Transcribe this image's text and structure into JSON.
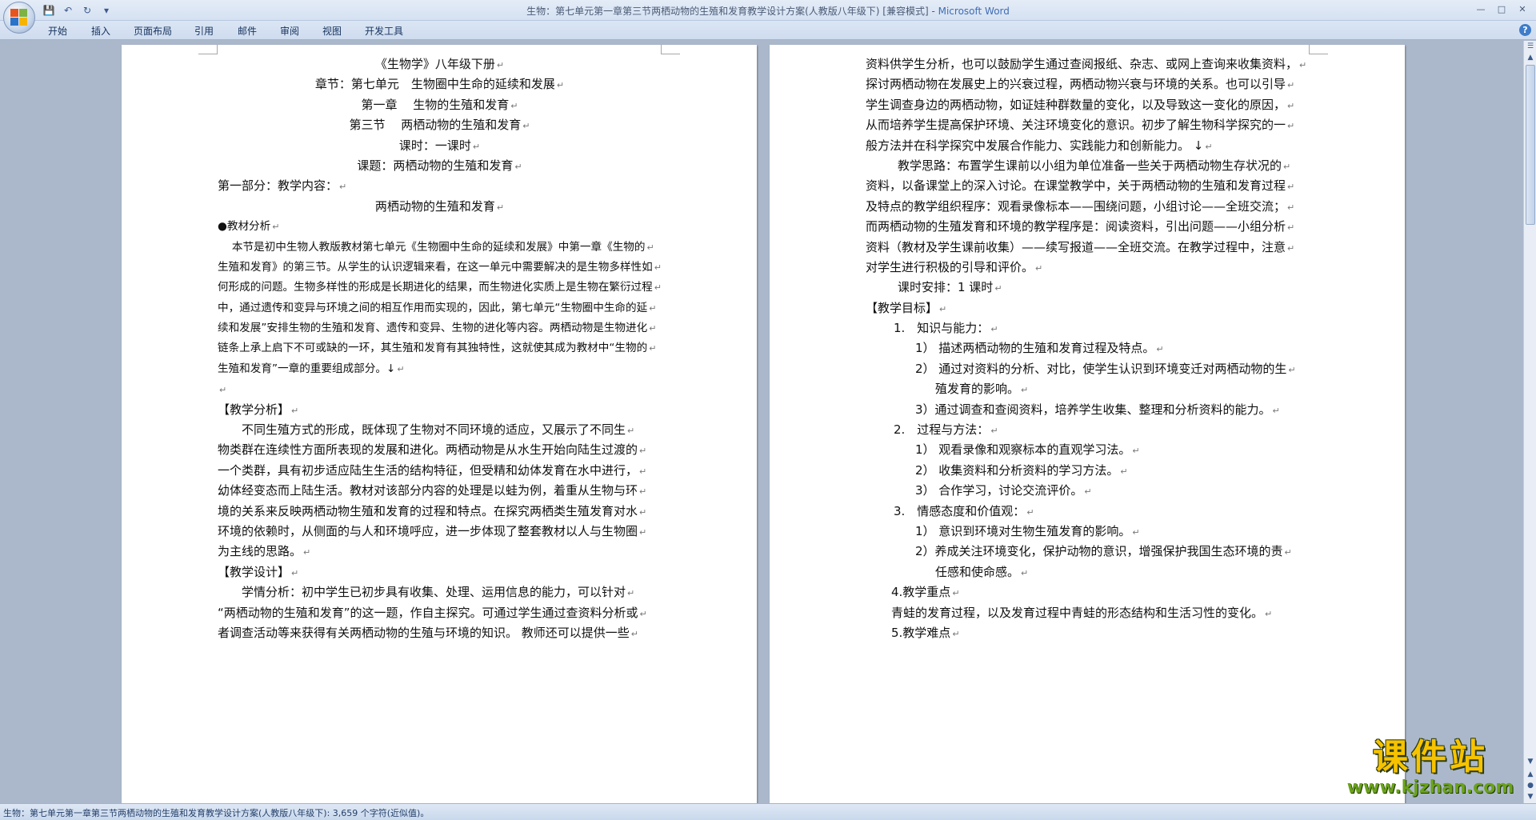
{
  "window": {
    "title_doc": "生物：第七单元第一章第三节两栖动物的生殖和发育教学设计方案(人教版八年级下) [兼容模式]",
    "title_separator": " - ",
    "title_app": "Microsoft Word"
  },
  "ribbon": {
    "tabs": [
      "开始",
      "插入",
      "页面布局",
      "引用",
      "邮件",
      "审阅",
      "视图",
      "开发工具"
    ],
    "help": "?"
  },
  "left_page": {
    "lines": [
      {
        "text": "《生物学》八年级下册",
        "center": true
      },
      {
        "text": "章节：第七单元　生物圈中生命的延续和发展",
        "center": true
      },
      {
        "text": "第一章　 生物的生殖和发育",
        "center": true
      },
      {
        "text": "第三节　 两栖动物的生殖和发育",
        "center": true
      },
      {
        "text": "课时：一课时",
        "center": true
      },
      {
        "text": "课题：两栖动物的生殖和发育",
        "center": true
      },
      {
        "text": "第一部分：教学内容：",
        "center": false
      },
      {
        "text": "两栖动物的生殖和发育",
        "center": true
      },
      {
        "text": "●教材分析",
        "center": false,
        "small": true
      },
      {
        "text": "　 本节是初中生物人教版教材第七单元《生物圈中生命的延续和发展》中第一章《生物的",
        "center": false,
        "small": true
      },
      {
        "text": "生殖和发育》的第三节。从学生的认识逻辑来看，在这一单元中需要解决的是生物多样性如",
        "center": false,
        "small": true
      },
      {
        "text": "何形成的问题。生物多样性的形成是长期进化的结果，而生物进化实质上是生物在繁衍过程",
        "center": false,
        "small": true
      },
      {
        "text": "中，通过遗传和变异与环境之间的相互作用而实现的，因此，第七单元“生物圈中生命的延",
        "center": false,
        "small": true
      },
      {
        "text": "续和发展”安排生物的生殖和发育、遗传和变异、生物的进化等内容。两栖动物是生物进化",
        "center": false,
        "small": true
      },
      {
        "text": "链条上承上启下不可或缺的一环，其生殖和发育有其独特性，这就使其成为教材中“生物的",
        "center": false,
        "small": true
      },
      {
        "text": "生殖和发育”一章的重要组成部分。↓",
        "center": false,
        "small": true
      },
      {
        "text": "",
        "center": false
      },
      {
        "text": "【教学分析】",
        "center": false
      },
      {
        "text": "　　不同生殖方式的形成，既体现了生物对不同环境的适应，又展示了不同生",
        "center": false
      },
      {
        "text": "物类群在连续性方面所表现的发展和进化。两栖动物是从水生开始向陆生过渡的",
        "center": false
      },
      {
        "text": "一个类群，具有初步适应陆生生活的结构特征，但受精和幼体发育在水中进行，",
        "center": false
      },
      {
        "text": "幼体经变态而上陆生活。教材对该部分内容的处理是以蛙为例，着重从生物与环",
        "center": false
      },
      {
        "text": "境的关系来反映两栖动物生殖和发育的过程和特点。在探究两栖类生殖发育对水",
        "center": false
      },
      {
        "text": "环境的依赖时，从侧面的与人和环境呼应，进一步体现了整套教材以人与生物圈",
        "center": false
      },
      {
        "text": "为主线的思路。",
        "center": false
      },
      {
        "text": "【教学设计】",
        "center": false
      },
      {
        "text": "　　学情分析：初中学生已初步具有收集、处理、运用信息的能力，可以针对",
        "center": false
      },
      {
        "text": "“两栖动物的生殖和发育”的这一题，作自主探究。可通过学生通过查资料分析或",
        "center": false
      },
      {
        "text": "者调查活动等来获得有关两栖动物的生殖与环境的知识。 教师还可以提供一些",
        "center": false
      }
    ]
  },
  "right_page": {
    "lines": [
      {
        "text": "资料供学生分析，也可以鼓励学生通过查阅报纸、杂志、或网上查询来收集资料，",
        "indent": 0
      },
      {
        "text": "探讨两栖动物在发展史上的兴衰过程，两栖动物兴衰与环境的关系。也可以引导",
        "indent": 0
      },
      {
        "text": "学生调查身边的两栖动物，如证娃种群数量的变化，以及导致这一变化的原因，",
        "indent": 0
      },
      {
        "text": "从而培养学生提高保护环境、关注环境变化的意识。初步了解生物科学探究的一",
        "indent": 0
      },
      {
        "text": "般方法并在科学探究中发展合作能力、实践能力和创新能力。 ↓",
        "indent": 0
      },
      {
        "text": "教学思路：布置学生课前以小组为单位准备一些关于两栖动物生存状况的",
        "indent": 40
      },
      {
        "text": "资料，以备课堂上的深入讨论。在课堂教学中，关于两栖动物的生殖和发育过程",
        "indent": 0
      },
      {
        "text": "及特点的教学组织程序：观看录像标本——围绕问题，小组讨论——全班交流；",
        "indent": 0
      },
      {
        "text": "而两栖动物的生殖发育和环境的教学程序是：阅读资料，引出问题——小组分析",
        "indent": 0
      },
      {
        "text": "资料（教材及学生课前收集）——续写报道——全班交流。在教学过程中，注意",
        "indent": 0
      },
      {
        "text": "对学生进行积极的引导和评价。",
        "indent": 0
      },
      {
        "text": "课时安排：1 课时",
        "indent": 40
      },
      {
        "text": "【教学目标】",
        "indent": 0
      },
      {
        "text": "1.　知识与能力：",
        "indent": 35
      },
      {
        "text": "1） 描述两栖动物的生殖和发育过程及特点。",
        "indent": 62
      },
      {
        "text": "2） 通过对资料的分析、对比，使学生认识到环境变迁对两栖动物的生",
        "indent": 62
      },
      {
        "text": "殖发育的影响。",
        "indent": 87
      },
      {
        "text": "3）通过调查和查阅资料，培养学生收集、整理和分析资料的能力。",
        "indent": 62
      },
      {
        "text": "2.　过程与方法：",
        "indent": 35
      },
      {
        "text": "1） 观看录像和观察标本的直观学习法。",
        "indent": 62
      },
      {
        "text": "2） 收集资料和分析资料的学习方法。",
        "indent": 62
      },
      {
        "text": "3） 合作学习，讨论交流评价。",
        "indent": 62
      },
      {
        "text": "3.　情感态度和价值观：",
        "indent": 35
      },
      {
        "text": "1） 意识到环境对生物生殖发育的影响。",
        "indent": 62
      },
      {
        "text": "2）养成关注环境变化，保护动物的意识，增强保护我国生态环境的责",
        "indent": 62
      },
      {
        "text": "任感和使命感。",
        "indent": 87
      },
      {
        "text": "4.教学重点",
        "indent": 32
      },
      {
        "text": "青蛙的发育过程，以及发育过程中青蛙的形态结构和生活习性的变化。",
        "indent": 32
      },
      {
        "text": "5.教学难点",
        "indent": 32
      }
    ]
  },
  "statusbar": {
    "text": "生物：第七单元第一章第三节两栖动物的生殖和发育教学设计方案(人教版八年级下): 3,659 个字符(近似值)。"
  },
  "watermark": {
    "title": "课件站",
    "url": "www.kjzhan.com"
  },
  "colors": {
    "workspace_bg": "#abb8cb",
    "ribbon_bg": "#d5e1f2",
    "title_app": "#3f6db3",
    "watermark_yellow": "#f7c300",
    "watermark_green": "#6aa21c"
  }
}
